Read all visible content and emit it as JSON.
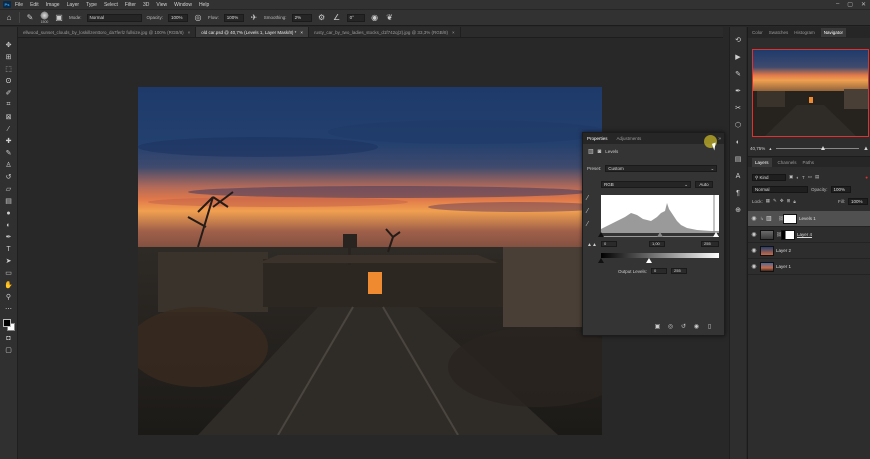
{
  "menubar": {
    "logo": "Ps",
    "items": [
      "File",
      "Edit",
      "Image",
      "Layer",
      "Type",
      "Select",
      "Filter",
      "3D",
      "View",
      "Window",
      "Help"
    ],
    "window_controls": [
      "–",
      "▢",
      "✕"
    ]
  },
  "options_bar": {
    "brush_size": "1500",
    "mode_label": "Mode:",
    "mode_value": "Normal",
    "opacity_label": "Opacity:",
    "opacity_value": "100%",
    "flow_label": "Flow:",
    "flow_value": "100%",
    "smoothing_label": "Smoothing:",
    "smoothing_value": "2%",
    "angle_value": "0°"
  },
  "tabs": [
    {
      "label": "ellwood_sunset_clouds_by_loskillzenttoro_da7ferlz fullsize.jpg @ 100% (RGB/8)",
      "close": "×",
      "active": false
    },
    {
      "label": "old car.psd @ 40,7% (Levels 1, Layer Mask/8) *",
      "close": "×",
      "active": true
    },
    {
      "label": "rusty_car_by_two_ladies_stocks_d1f742q(2).jpg @ 33,3% (RGB/8)",
      "close": "×",
      "active": false
    }
  ],
  "tools": [
    "move-icon",
    "artboard-icon",
    "marquee-icon",
    "lasso-icon",
    "quick-select-icon",
    "crop-icon",
    "frame-icon",
    "eyedropper-icon",
    "healing-icon",
    "brush-icon",
    "stamp-icon",
    "history-brush-icon",
    "eraser-icon",
    "gradient-icon",
    "blur-icon",
    "dodge-icon",
    "pen-icon",
    "type-icon",
    "path-select-icon",
    "shape-icon",
    "hand-icon",
    "zoom-icon",
    "more-icon"
  ],
  "right_panel": {
    "tabs": [
      "Color",
      "Swatches",
      "Histogram",
      "Navigator"
    ],
    "active_tab": "Navigator",
    "zoom": "40,75%",
    "layers_tabs": [
      "Layers",
      "Channels",
      "Paths"
    ],
    "kind_label": "Kind",
    "blend_mode": "Normal",
    "opacity_label": "Opacity:",
    "opacity_value": "100%",
    "lock_label": "Lock:",
    "fill_label": "Fill:",
    "fill_value": "100%",
    "layers": [
      {
        "name": "Levels 1",
        "selected": true
      },
      {
        "name": "Layer 4",
        "selected": false
      },
      {
        "name": "Layer 2",
        "selected": false
      },
      {
        "name": "Layer 1",
        "selected": false
      }
    ]
  },
  "properties": {
    "tabs": [
      "Properties",
      "Adjustments"
    ],
    "active_tab": "Properties",
    "title": "Levels",
    "preset_label": "Preset:",
    "preset_value": "Custom",
    "channel": "RGB",
    "auto_label": "Auto",
    "input_black": "0",
    "input_mid": "1,00",
    "input_white": "255",
    "output_label": "Output Levels:",
    "output_black": "0",
    "output_white": "255",
    "collapse": "»"
  }
}
